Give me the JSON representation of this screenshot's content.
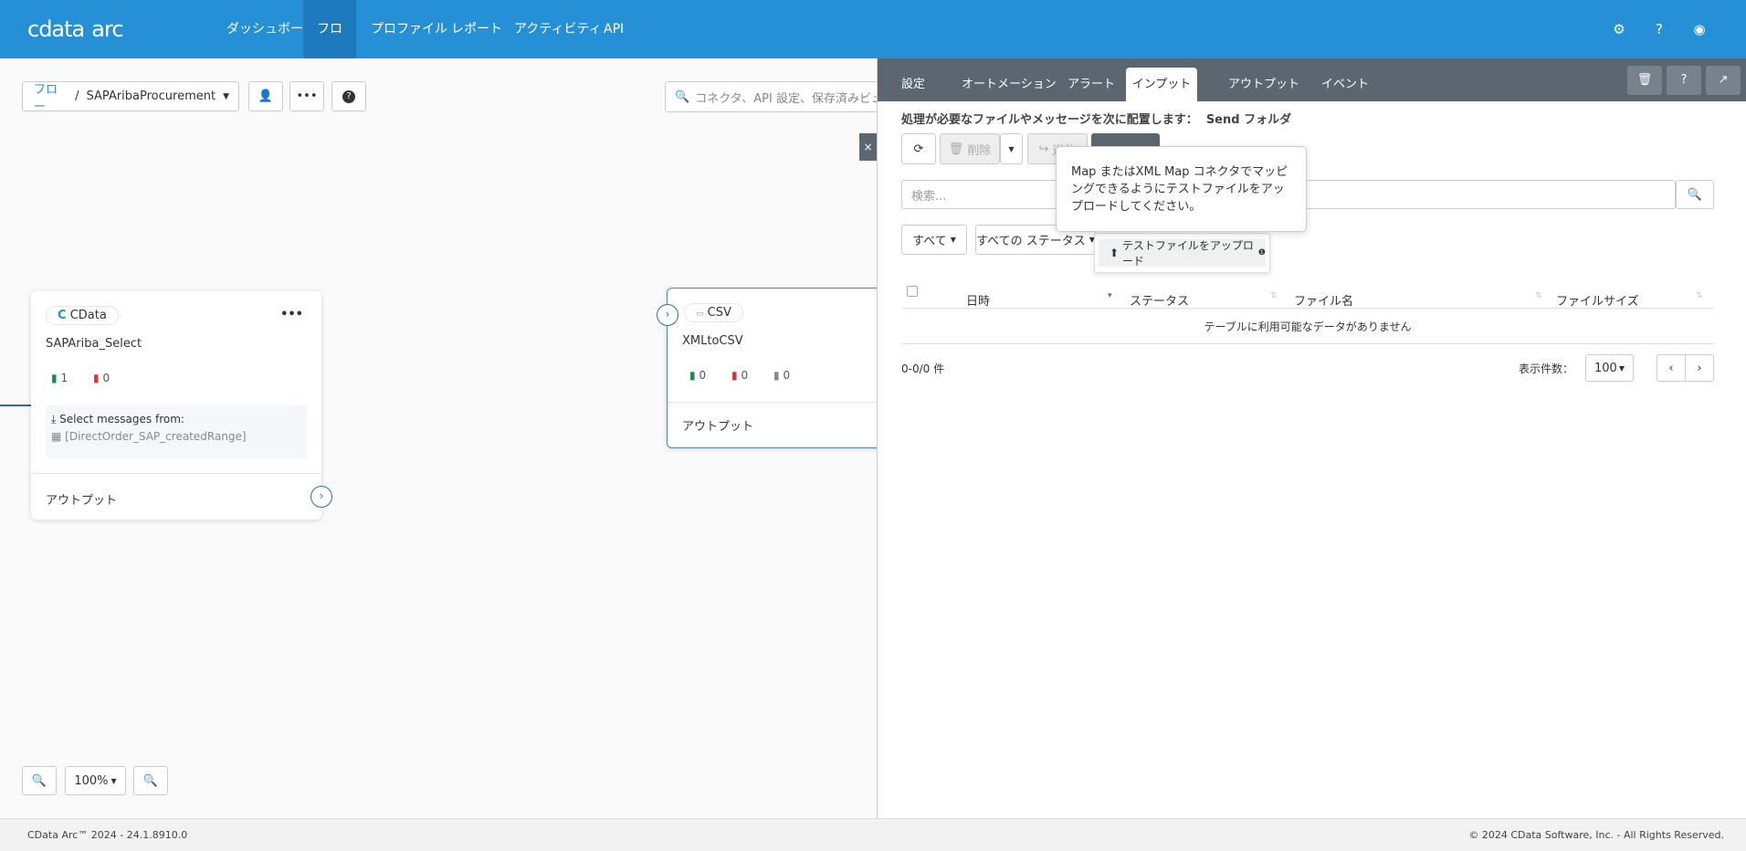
{
  "header": {
    "logo": "cdata",
    "logo_suffix": "arc",
    "nav": [
      "ダッシュボード",
      "フロー",
      "プロファイル",
      "レポート",
      "アクティビティ",
      "API"
    ],
    "active_nav": "フロー"
  },
  "toolbar": {
    "breadcrumb_root": "フロー",
    "breadcrumb_sep": "/",
    "flow_name": "SAPAribaProcurement",
    "search_placeholder": "コネクタ、API 設定、保存済みビューを検索"
  },
  "nodes": [
    {
      "type": "CData",
      "name": "SAPAriba_Select",
      "success": "1",
      "error": "0",
      "select_label": "Select messages from:",
      "select_table": "[DirectOrder_SAP_createdRange]",
      "output": "アウトプット"
    },
    {
      "type": "CSV",
      "name": "XMLtoCSV",
      "success": "0",
      "error": "0",
      "pending": "0",
      "output": "アウトプット"
    }
  ],
  "zoom": {
    "level": "100%"
  },
  "panel": {
    "tabs": [
      "設定",
      "オートメーション",
      "アラート",
      "インプット",
      "アウトプット",
      "イベント"
    ],
    "active_tab": "インプット",
    "info_label": "処理が必要なファイルやメッセージを次に配置します：",
    "info_folder": "Send フォルダ",
    "delete_label": "削除",
    "forward_label": "送信",
    "tooltip": "Map またはXML Map コネクタでマッピングできるようにテストファイルをアップロードしてください。",
    "search_placeholder": "検索...",
    "filter_all": "すべて",
    "filter_status": "すべての ステータス",
    "upload_label": "テストファイルをアップロード",
    "columns": [
      "日時",
      "ステータス",
      "ファイル名",
      "ファイルサイズ"
    ],
    "empty_message": "テーブルに利用可能なデータがありません",
    "count": "0-0/0 件",
    "page_size_label": "表示件数：",
    "page_size": "100"
  },
  "footer": {
    "version": "CData Arc™ 2024 - 24.1.8910.0",
    "copyright": "© 2024 CData Software, Inc. - All Rights Reserved."
  }
}
